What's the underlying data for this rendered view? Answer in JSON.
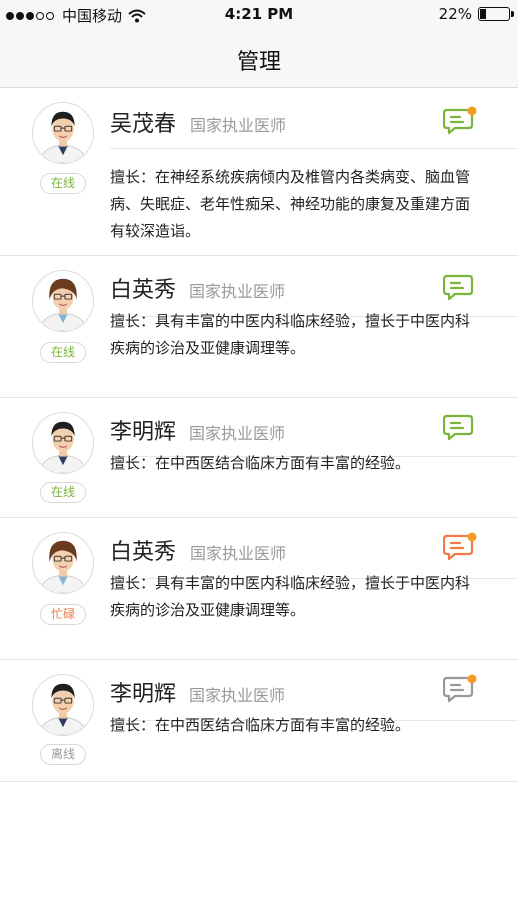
{
  "status_bar": {
    "carrier": "中国移动",
    "time": "4:21 PM",
    "battery": "22%",
    "battery_level": 0.22
  },
  "nav": {
    "title": "管理"
  },
  "colors": {
    "online": "#7bb33b",
    "busy": "#f07a48",
    "offline": "#999999",
    "dot": "#f39c26"
  },
  "doctors": [
    {
      "name": "吴茂春",
      "title": "国家执业医师",
      "status": "在线",
      "status_key": "online",
      "chat_state": "unread-green",
      "desc": "擅长：在神经系统疾病倾内及椎管内各类病变、脑血管病、失眠症、老年性痴呆、神经功能的康复及重建方面有较深造诣。"
    },
    {
      "name": "白英秀",
      "title": "国家执业医师",
      "status": "在线",
      "status_key": "online",
      "chat_state": "green",
      "desc": "擅长：具有丰富的中医内科临床经验，擅长于中医内科疾病的诊治及亚健康调理等。"
    },
    {
      "name": "李明辉",
      "title": "国家执业医师",
      "status": "在线",
      "status_key": "online",
      "chat_state": "green",
      "desc": "擅长：在中西医结合临床方面有丰富的经验。"
    },
    {
      "name": "白英秀",
      "title": "国家执业医师",
      "status": "忙碌",
      "status_key": "busy",
      "chat_state": "unread-orange",
      "desc": "擅长：具有丰富的中医内科临床经验，擅长于中医内科疾病的诊治及亚健康调理等。"
    },
    {
      "name": "李明辉",
      "title": "国家执业医师",
      "status": "离线",
      "status_key": "offline",
      "chat_state": "unread-gray",
      "desc": "擅长：在中西医结合临床方面有丰富的经验。"
    }
  ]
}
